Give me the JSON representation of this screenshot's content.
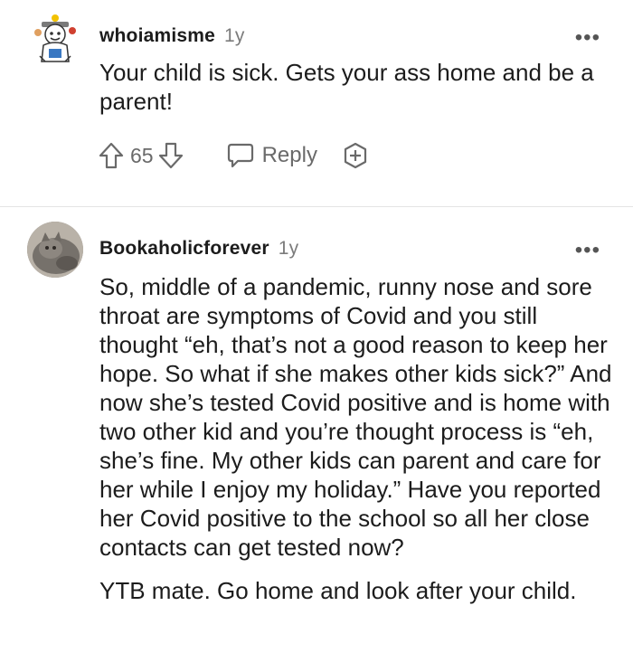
{
  "comments": [
    {
      "username": "whoiamisme",
      "age": "1y",
      "more_label": "•••",
      "body": "Your child is sick. Gets your ass home and be a parent!",
      "score": "65",
      "reply_label": "Reply"
    },
    {
      "username": "Bookaholicforever",
      "age": "1y",
      "more_label": "•••",
      "paragraphs": [
        "So, middle of a pandemic, runny nose and sore throat are symptoms of Covid and you still thought “eh, that’s not a good reason to keep her hope. So what if she makes other kids sick?” And now she’s tested Covid positive and is home with two other kid and you’re thought process is “eh, she’s fine. My other kids can parent and care for her while I enjoy my holiday.” Have you reported her Covid positive to the school so all her close contacts can get tested now?",
        "YTB mate. Go home and look after your child."
      ]
    }
  ],
  "colors": {
    "text": "#1c1c1c",
    "meta": "#7c7c7c",
    "action": "#6a6a6a",
    "divider": "#e4e4e4"
  }
}
